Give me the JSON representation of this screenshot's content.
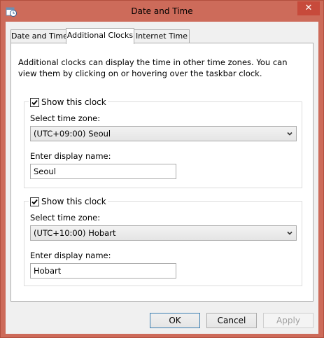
{
  "window": {
    "title": "Date and Time",
    "close_glyph": "✕",
    "app_icon": "clock-calendar-icon"
  },
  "tabs": [
    {
      "label": "Date and Time",
      "active": false
    },
    {
      "label": "Additional Clocks",
      "active": true
    },
    {
      "label": "Internet Time",
      "active": false
    }
  ],
  "intro_text": "Additional clocks can display the time in other time zones. You can view them by clicking on or hovering over the taskbar clock.",
  "clocks": [
    {
      "show_label": "Show this clock",
      "checked": true,
      "timezone_label": "Select time zone:",
      "timezone_value": "(UTC+09:00) Seoul",
      "name_label": "Enter display name:",
      "name_value": "Seoul"
    },
    {
      "show_label": "Show this clock",
      "checked": true,
      "timezone_label": "Select time zone:",
      "timezone_value": "(UTC+10:00) Hobart",
      "name_label": "Enter display name:",
      "name_value": "Hobart"
    }
  ],
  "buttons": {
    "ok": "OK",
    "cancel": "Cancel",
    "apply": "Apply"
  },
  "colors": {
    "frame": "#cd6b5a",
    "close": "#c74a3b",
    "default_button_border": "#3c7fb1"
  }
}
